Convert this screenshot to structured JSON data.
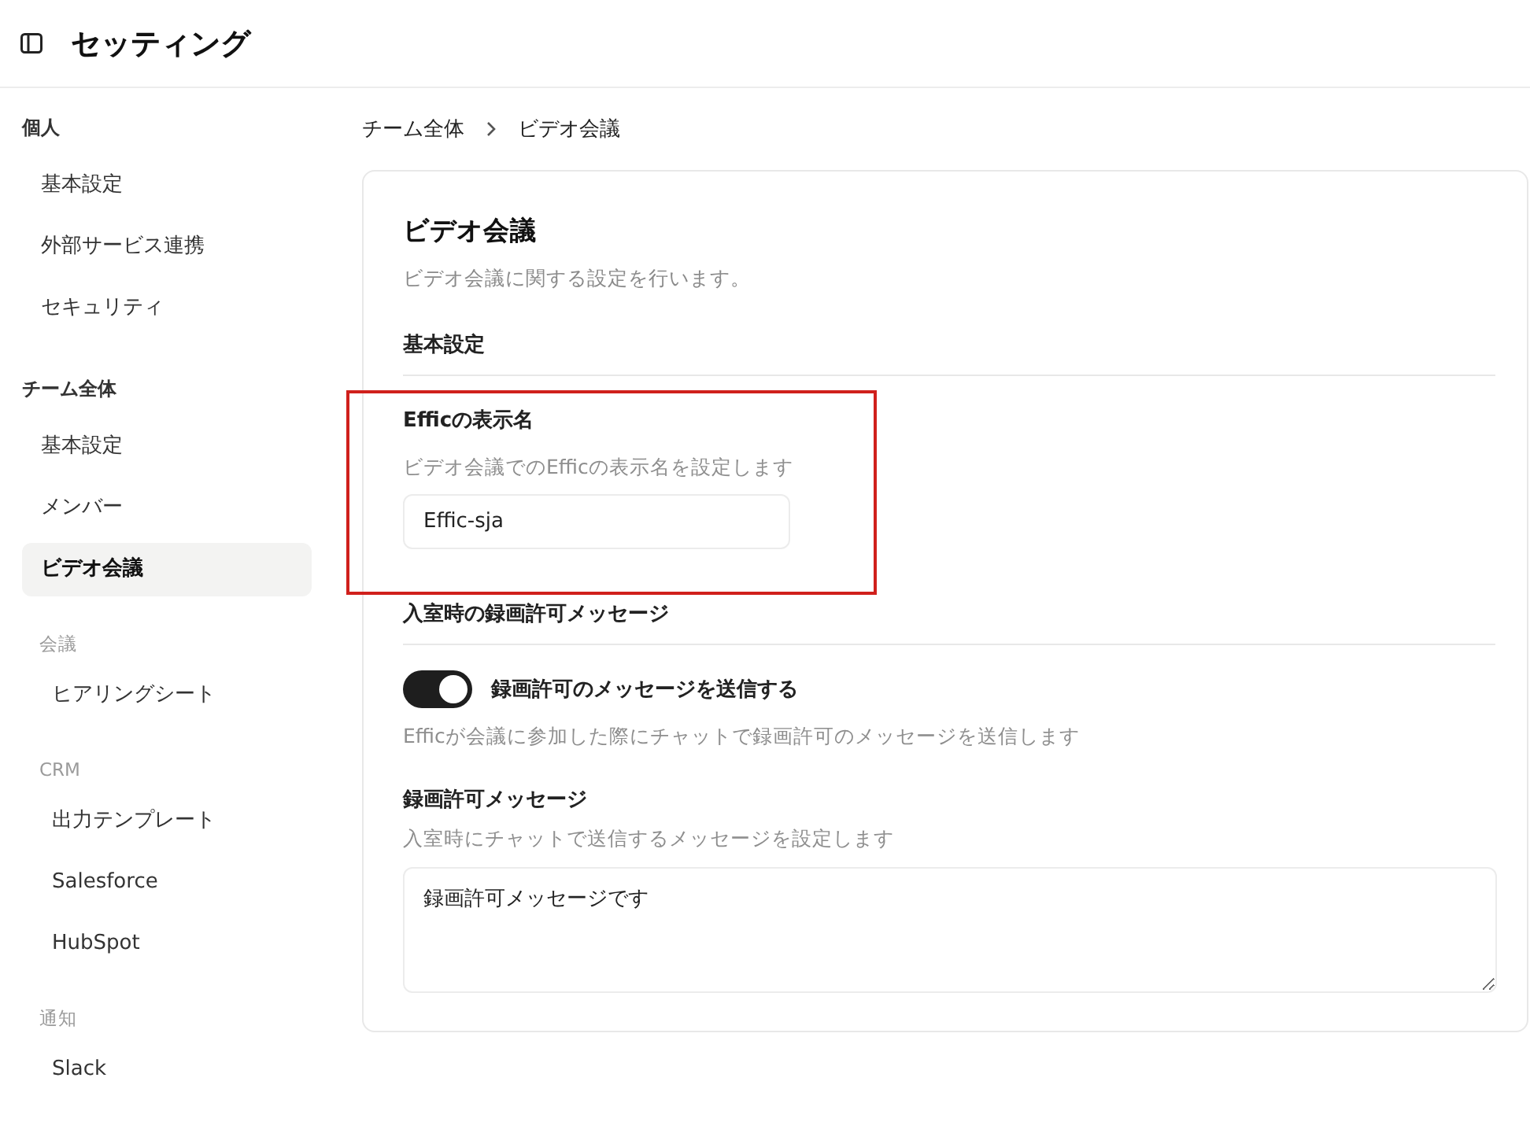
{
  "header": {
    "title": "セッティング"
  },
  "sidebar": {
    "groups": [
      {
        "label": "個人",
        "items": [
          {
            "label": "基本設定",
            "selected": false
          },
          {
            "label": "外部サービス連携",
            "selected": false
          },
          {
            "label": "セキュリティ",
            "selected": false
          }
        ]
      },
      {
        "label": "チーム全体",
        "items": [
          {
            "label": "基本設定",
            "selected": false
          },
          {
            "label": "メンバー",
            "selected": false
          },
          {
            "label": "ビデオ会議",
            "selected": true
          }
        ],
        "subgroups": [
          {
            "label": "会議",
            "items": [
              {
                "label": "ヒアリングシート",
                "selected": false
              }
            ]
          },
          {
            "label": "CRM",
            "items": [
              {
                "label": "出力テンプレート",
                "selected": false
              },
              {
                "label": "Salesforce",
                "selected": false
              },
              {
                "label": "HubSpot",
                "selected": false
              }
            ]
          },
          {
            "label": "通知",
            "items": [
              {
                "label": "Slack",
                "selected": false
              }
            ]
          }
        ]
      }
    ]
  },
  "breadcrumb": [
    "チーム全体",
    "ビデオ会議"
  ],
  "panel": {
    "title": "ビデオ会議",
    "description": "ビデオ会議に関する設定を行います。",
    "sections": [
      {
        "heading": "基本設定",
        "fields": [
          {
            "kind": "text",
            "label": "Efficの表示名",
            "help": "ビデオ会議でのEfficの表示名を設定します",
            "value": "Effic-sja",
            "highlighted": true
          }
        ]
      },
      {
        "heading": "入室時の録画許可メッセージ",
        "fields": [
          {
            "kind": "toggle",
            "label": "録画許可のメッセージを送信する",
            "on": true,
            "help": "Efficが会議に参加した際にチャットで録画許可のメッセージを送信します",
            "highlighted": false
          },
          {
            "kind": "textarea",
            "label": "録画許可メッセージ",
            "help": "入室時にチャットで送信するメッセージを設定します",
            "value": "録画許可メッセージです",
            "highlighted": false
          }
        ]
      }
    ]
  }
}
